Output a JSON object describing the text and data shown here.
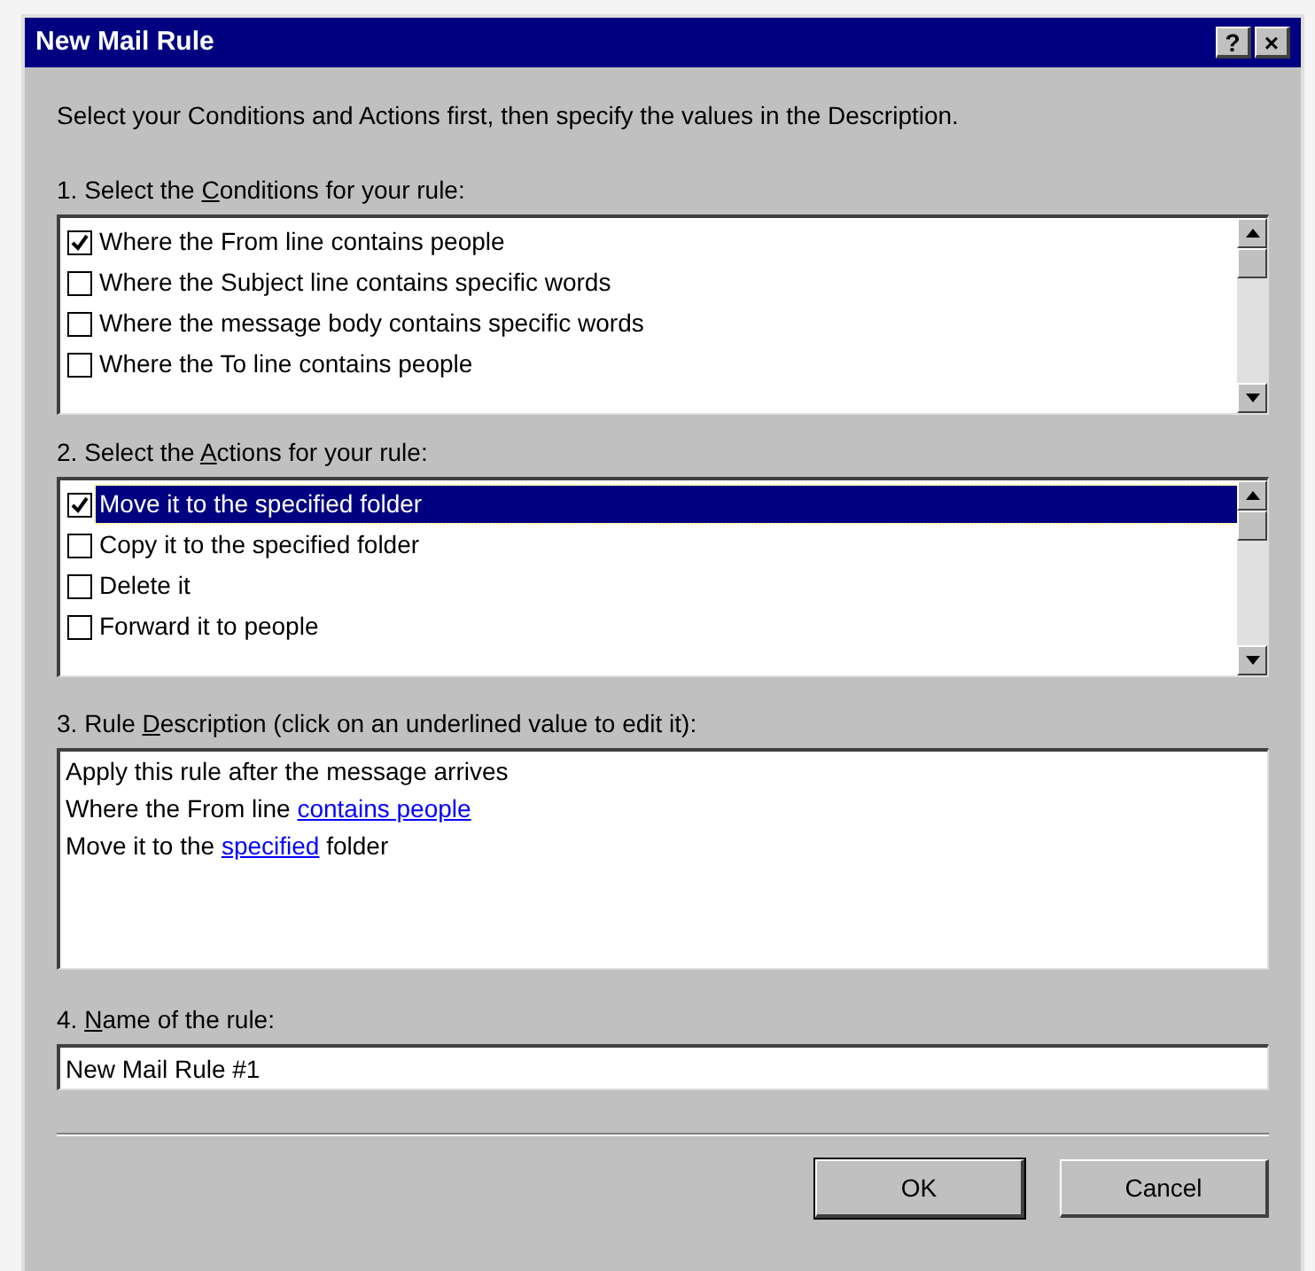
{
  "window": {
    "title": "New Mail Rule",
    "title_buttons": [
      "?",
      "×"
    ]
  },
  "intro": "Select your Conditions and Actions first, then specify the values in the Description.",
  "conditions": {
    "label": {
      "before": "1. Select the ",
      "key": "C",
      "after": "onditions for your rule:"
    },
    "items": [
      {
        "text": "Where the From line contains people",
        "checked": true,
        "selected": false
      },
      {
        "text": "Where the Subject line contains specific words",
        "checked": false,
        "selected": false
      },
      {
        "text": "Where the message body contains specific words",
        "checked": false,
        "selected": false
      },
      {
        "text": "Where the To line contains people",
        "checked": false,
        "selected": false
      }
    ]
  },
  "actions": {
    "label": {
      "before": "2. Select the ",
      "key": "A",
      "after": "ctions for your rule:"
    },
    "items": [
      {
        "text": "Move it to the specified folder",
        "checked": true,
        "selected": true
      },
      {
        "text": "Copy it to the specified folder",
        "checked": false,
        "selected": false
      },
      {
        "text": "Delete it",
        "checked": false,
        "selected": false
      },
      {
        "text": "Forward it to people",
        "checked": false,
        "selected": false
      }
    ]
  },
  "description": {
    "label": {
      "before": "3. Rule ",
      "key": "D",
      "after": "escription (click on an underlined value to edit it):"
    },
    "lines": [
      [
        {
          "text": "Apply this rule after the message arrives",
          "link": false
        }
      ],
      [
        {
          "text": "Where the From line ",
          "link": false
        },
        {
          "text": "contains people",
          "link": true
        }
      ],
      [
        {
          "text": "Move it to the ",
          "link": false
        },
        {
          "text": "specified",
          "link": true
        },
        {
          "text": " folder",
          "link": false
        }
      ]
    ]
  },
  "rule_name": {
    "label": {
      "before": "4. ",
      "key": "N",
      "after": "ame of the rule:"
    },
    "value": "New Mail Rule #1"
  },
  "buttons": [
    {
      "label": "OK",
      "default": true
    },
    {
      "label": "Cancel",
      "default": false
    }
  ]
}
